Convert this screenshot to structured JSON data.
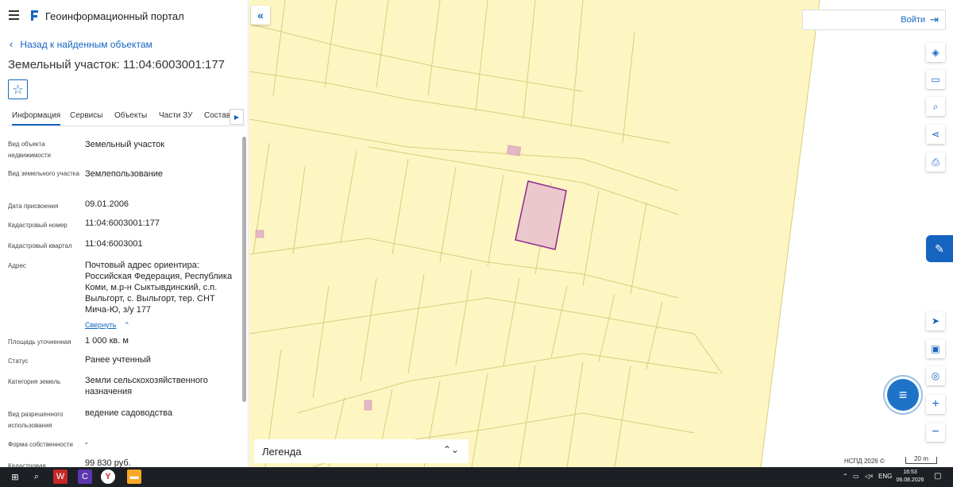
{
  "header": {
    "app_title": "Геоинформационный портал"
  },
  "panel": {
    "back_link": "Назад к найденным объектам",
    "object_title": "Земельный участок: 11:04:6003001:177",
    "tabs": [
      "Информация",
      "Сервисы",
      "Объекты",
      "Части ЗУ",
      "Состав"
    ],
    "rows": [
      {
        "label": "Вид объекта недвижимости",
        "value": "Земельный участок"
      },
      {
        "label": "Вид земельного участка",
        "value": "Землепользование"
      },
      {
        "label": "Дата присвоения",
        "value": "09.01.2006"
      },
      {
        "label": "Кадастровый номер",
        "value": "11:04:6003001:177"
      },
      {
        "label": "Кадастровый квартал",
        "value": "11:04:6003001"
      },
      {
        "label": "Адрес",
        "value": "Почтовый адрес ориентира: Российская Федерация, Республика Коми, м.р-н Сыктывдинский, с.п. Выльгорт, с. Выльгорт, тер. СНТ Мича-Ю, з/у 177"
      },
      {
        "label": "Площадь уточненная",
        "value": "1 000 кв. м"
      },
      {
        "label": "Статус",
        "value": "Ранее учтенный"
      },
      {
        "label": "Категория земель",
        "value": "Земли сельскохозяйственного назначения"
      },
      {
        "label": "Вид разрешенного использования",
        "value": "ведение садоводства"
      },
      {
        "label": "Форма собственности",
        "value": "-"
      },
      {
        "label": "Кадастровая",
        "value": "99 830 руб."
      }
    ],
    "collapse_link": "Свернуть"
  },
  "map": {
    "login_label": "Войти",
    "legend_label": "Легенда",
    "copyright": "НСПД 2026 ©",
    "scale_label": "20 m",
    "colors": {
      "parcel_fill": "#fdf6c3",
      "parcel_line": "#d6cf7a",
      "highlight_fill": "#ebc8cb",
      "highlight_stroke": "#8e2a8c",
      "building": "#e6b8c6"
    },
    "tools": [
      "layers-icon",
      "ruler-icon",
      "search-area-icon",
      "share-icon",
      "print-icon",
      "navigate-icon",
      "minimap-icon",
      "location-icon",
      "zoom-in-icon",
      "zoom-out-icon"
    ]
  },
  "taskbar": {
    "lang": "ENG",
    "time": "16:53",
    "date": "06.08.2026"
  }
}
